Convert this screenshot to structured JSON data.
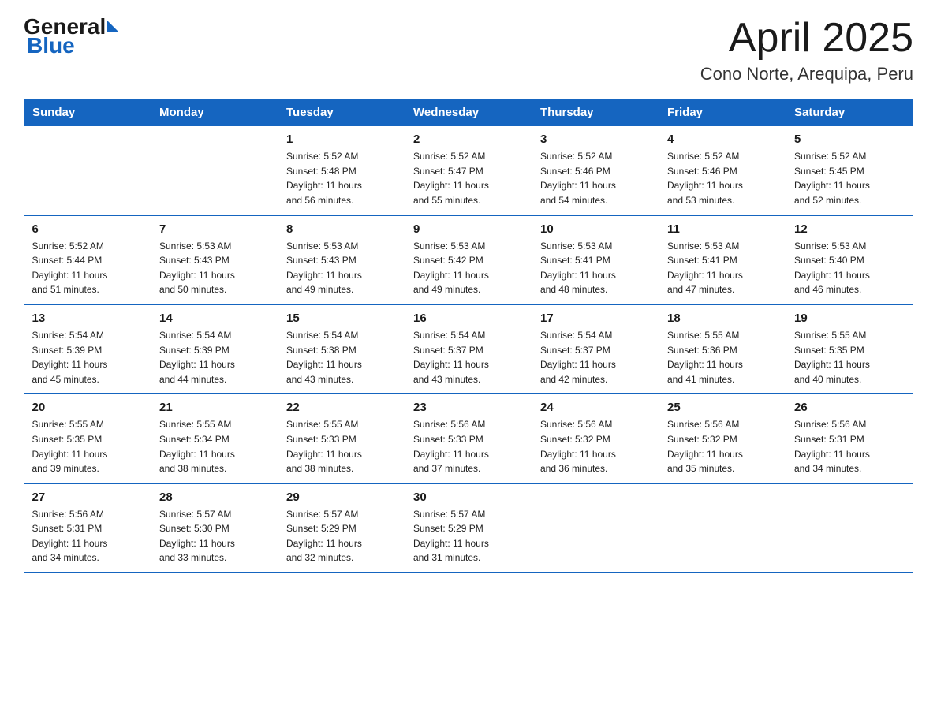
{
  "header": {
    "logo_general": "General",
    "logo_blue": "Blue",
    "month": "April 2025",
    "location": "Cono Norte, Arequipa, Peru"
  },
  "weekdays": [
    "Sunday",
    "Monday",
    "Tuesday",
    "Wednesday",
    "Thursday",
    "Friday",
    "Saturday"
  ],
  "weeks": [
    [
      {
        "day": "",
        "sunrise": "",
        "sunset": "",
        "daylight": ""
      },
      {
        "day": "",
        "sunrise": "",
        "sunset": "",
        "daylight": ""
      },
      {
        "day": "1",
        "sunrise": "Sunrise: 5:52 AM",
        "sunset": "Sunset: 5:48 PM",
        "daylight": "Daylight: 11 hours and 56 minutes."
      },
      {
        "day": "2",
        "sunrise": "Sunrise: 5:52 AM",
        "sunset": "Sunset: 5:47 PM",
        "daylight": "Daylight: 11 hours and 55 minutes."
      },
      {
        "day": "3",
        "sunrise": "Sunrise: 5:52 AM",
        "sunset": "Sunset: 5:46 PM",
        "daylight": "Daylight: 11 hours and 54 minutes."
      },
      {
        "day": "4",
        "sunrise": "Sunrise: 5:52 AM",
        "sunset": "Sunset: 5:46 PM",
        "daylight": "Daylight: 11 hours and 53 minutes."
      },
      {
        "day": "5",
        "sunrise": "Sunrise: 5:52 AM",
        "sunset": "Sunset: 5:45 PM",
        "daylight": "Daylight: 11 hours and 52 minutes."
      }
    ],
    [
      {
        "day": "6",
        "sunrise": "Sunrise: 5:52 AM",
        "sunset": "Sunset: 5:44 PM",
        "daylight": "Daylight: 11 hours and 51 minutes."
      },
      {
        "day": "7",
        "sunrise": "Sunrise: 5:53 AM",
        "sunset": "Sunset: 5:43 PM",
        "daylight": "Daylight: 11 hours and 50 minutes."
      },
      {
        "day": "8",
        "sunrise": "Sunrise: 5:53 AM",
        "sunset": "Sunset: 5:43 PM",
        "daylight": "Daylight: 11 hours and 49 minutes."
      },
      {
        "day": "9",
        "sunrise": "Sunrise: 5:53 AM",
        "sunset": "Sunset: 5:42 PM",
        "daylight": "Daylight: 11 hours and 49 minutes."
      },
      {
        "day": "10",
        "sunrise": "Sunrise: 5:53 AM",
        "sunset": "Sunset: 5:41 PM",
        "daylight": "Daylight: 11 hours and 48 minutes."
      },
      {
        "day": "11",
        "sunrise": "Sunrise: 5:53 AM",
        "sunset": "Sunset: 5:41 PM",
        "daylight": "Daylight: 11 hours and 47 minutes."
      },
      {
        "day": "12",
        "sunrise": "Sunrise: 5:53 AM",
        "sunset": "Sunset: 5:40 PM",
        "daylight": "Daylight: 11 hours and 46 minutes."
      }
    ],
    [
      {
        "day": "13",
        "sunrise": "Sunrise: 5:54 AM",
        "sunset": "Sunset: 5:39 PM",
        "daylight": "Daylight: 11 hours and 45 minutes."
      },
      {
        "day": "14",
        "sunrise": "Sunrise: 5:54 AM",
        "sunset": "Sunset: 5:39 PM",
        "daylight": "Daylight: 11 hours and 44 minutes."
      },
      {
        "day": "15",
        "sunrise": "Sunrise: 5:54 AM",
        "sunset": "Sunset: 5:38 PM",
        "daylight": "Daylight: 11 hours and 43 minutes."
      },
      {
        "day": "16",
        "sunrise": "Sunrise: 5:54 AM",
        "sunset": "Sunset: 5:37 PM",
        "daylight": "Daylight: 11 hours and 43 minutes."
      },
      {
        "day": "17",
        "sunrise": "Sunrise: 5:54 AM",
        "sunset": "Sunset: 5:37 PM",
        "daylight": "Daylight: 11 hours and 42 minutes."
      },
      {
        "day": "18",
        "sunrise": "Sunrise: 5:55 AM",
        "sunset": "Sunset: 5:36 PM",
        "daylight": "Daylight: 11 hours and 41 minutes."
      },
      {
        "day": "19",
        "sunrise": "Sunrise: 5:55 AM",
        "sunset": "Sunset: 5:35 PM",
        "daylight": "Daylight: 11 hours and 40 minutes."
      }
    ],
    [
      {
        "day": "20",
        "sunrise": "Sunrise: 5:55 AM",
        "sunset": "Sunset: 5:35 PM",
        "daylight": "Daylight: 11 hours and 39 minutes."
      },
      {
        "day": "21",
        "sunrise": "Sunrise: 5:55 AM",
        "sunset": "Sunset: 5:34 PM",
        "daylight": "Daylight: 11 hours and 38 minutes."
      },
      {
        "day": "22",
        "sunrise": "Sunrise: 5:55 AM",
        "sunset": "Sunset: 5:33 PM",
        "daylight": "Daylight: 11 hours and 38 minutes."
      },
      {
        "day": "23",
        "sunrise": "Sunrise: 5:56 AM",
        "sunset": "Sunset: 5:33 PM",
        "daylight": "Daylight: 11 hours and 37 minutes."
      },
      {
        "day": "24",
        "sunrise": "Sunrise: 5:56 AM",
        "sunset": "Sunset: 5:32 PM",
        "daylight": "Daylight: 11 hours and 36 minutes."
      },
      {
        "day": "25",
        "sunrise": "Sunrise: 5:56 AM",
        "sunset": "Sunset: 5:32 PM",
        "daylight": "Daylight: 11 hours and 35 minutes."
      },
      {
        "day": "26",
        "sunrise": "Sunrise: 5:56 AM",
        "sunset": "Sunset: 5:31 PM",
        "daylight": "Daylight: 11 hours and 34 minutes."
      }
    ],
    [
      {
        "day": "27",
        "sunrise": "Sunrise: 5:56 AM",
        "sunset": "Sunset: 5:31 PM",
        "daylight": "Daylight: 11 hours and 34 minutes."
      },
      {
        "day": "28",
        "sunrise": "Sunrise: 5:57 AM",
        "sunset": "Sunset: 5:30 PM",
        "daylight": "Daylight: 11 hours and 33 minutes."
      },
      {
        "day": "29",
        "sunrise": "Sunrise: 5:57 AM",
        "sunset": "Sunset: 5:29 PM",
        "daylight": "Daylight: 11 hours and 32 minutes."
      },
      {
        "day": "30",
        "sunrise": "Sunrise: 5:57 AM",
        "sunset": "Sunset: 5:29 PM",
        "daylight": "Daylight: 11 hours and 31 minutes."
      },
      {
        "day": "",
        "sunrise": "",
        "sunset": "",
        "daylight": ""
      },
      {
        "day": "",
        "sunrise": "",
        "sunset": "",
        "daylight": ""
      },
      {
        "day": "",
        "sunrise": "",
        "sunset": "",
        "daylight": ""
      }
    ]
  ]
}
